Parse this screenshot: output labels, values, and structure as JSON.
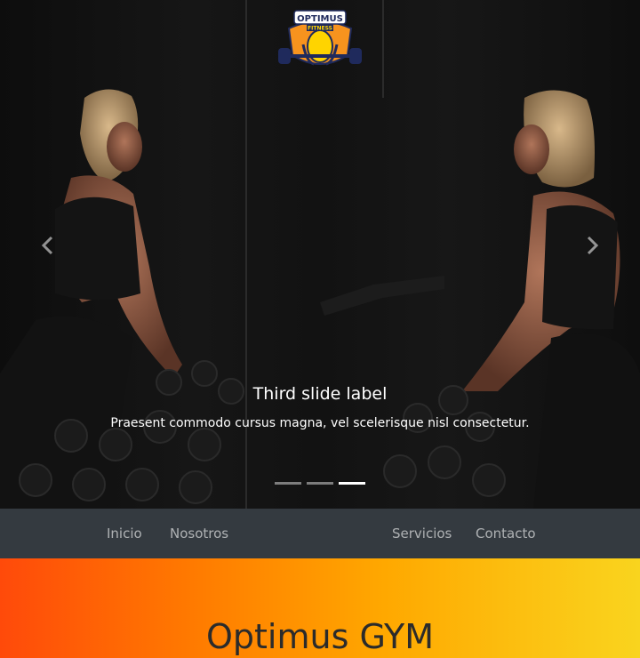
{
  "carousel": {
    "caption_title": "Third slide label",
    "caption_text": "Praesent commodo cursus magna, vel scelerisque nisl consectetur.",
    "prev_icon": "chevron-left-icon",
    "next_icon": "chevron-right-icon",
    "indicator_count": 3,
    "active_indicator": 3
  },
  "logo": {
    "text_line1": "OPTIMUS",
    "text_line2": "FITNESS",
    "colors": {
      "orange": "#f7931e",
      "navy": "#1f2a5c",
      "yellow": "#ffd400"
    }
  },
  "nav": {
    "items": [
      {
        "label": "Inicio"
      },
      {
        "label": "Nosotros"
      },
      {
        "label": "Servicios"
      },
      {
        "label": "Contacto"
      }
    ]
  },
  "hero": {
    "title": "Optimus GYM"
  }
}
